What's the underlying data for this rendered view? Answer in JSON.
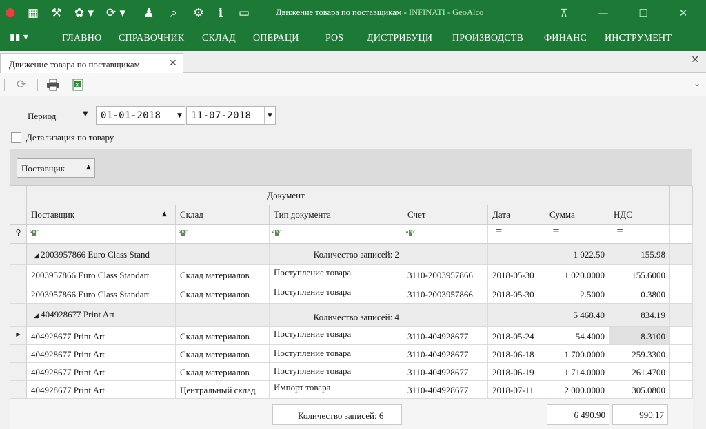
{
  "window": {
    "title": "Движение товара по поставщикам",
    "title_separator": " - ",
    "app_name": "INFINATI - GeoAlco",
    "accent_color": "#1c7a36"
  },
  "quick_toolbar": [
    {
      "name": "app-logo-icon",
      "glyph": "⬢"
    },
    {
      "name": "calendar-icon",
      "glyph": "▦"
    },
    {
      "name": "tools-icon",
      "glyph": "⚒"
    },
    {
      "name": "palette-icon",
      "glyph": "✿"
    },
    {
      "name": "refresh-icon",
      "glyph": "⟳"
    },
    {
      "name": "user-icon",
      "glyph": "♟"
    },
    {
      "name": "search-icon",
      "glyph": "⌕"
    },
    {
      "name": "settings-icon",
      "glyph": "⚙"
    },
    {
      "name": "info-icon",
      "glyph": "ℹ"
    },
    {
      "name": "chat-icon",
      "glyph": "▭"
    }
  ],
  "menu": {
    "app_button": "▮▮",
    "items": [
      "ГЛАВНО",
      "СПРАВОЧНИК",
      "СКЛАД",
      "ОПЕРАЦИ",
      "POS",
      "ДИСТРИБУЦИ",
      "ПРОИЗВОДСТВ",
      "ФИНАНС",
      "ИНСТРУМЕНТ"
    ]
  },
  "tab": {
    "label": "Движение товара по поставщикам",
    "close": "✕"
  },
  "toolbar_icons": [
    "refresh-icon",
    "print-icon",
    "excel-icon"
  ],
  "filters": {
    "period_label": "Период",
    "date_from": "01-01-2018",
    "date_to": "11-07-2018",
    "detail_label": "Детализация по товару",
    "detail_checked": false
  },
  "group_panel": {
    "chip_label": "Поставщик"
  },
  "grid": {
    "band_header": "Документ",
    "columns": [
      "Поставщик",
      "Склад",
      "Тип документа",
      "Счет",
      "Дата",
      "Сумма",
      "НДС"
    ],
    "groups": [
      {
        "title": "2003957866  Euro Class Stand",
        "count_text": "Количество записей: 2",
        "sum": "1 022.50",
        "vat": "155.98",
        "rows": [
          {
            "supplier": "2003957866  Euro Class Standart",
            "warehouse": "Склад материалов",
            "doc_type": "Поступление товара",
            "account": "3110-2003957866",
            "date": "2018-05-30",
            "sum": "1 020.0000",
            "vat": "155.6000"
          },
          {
            "supplier": "2003957866  Euro Class Standart",
            "warehouse": "Склад материалов",
            "doc_type": "Поступление товара",
            "account": "3110-2003957866",
            "date": "2018-05-30",
            "sum": "2.5000",
            "vat": "0.3800"
          }
        ]
      },
      {
        "title": "404928677  Print Art",
        "count_text": "Количество записей: 4",
        "sum": "5 468.40",
        "vat": "834.19",
        "rows": [
          {
            "supplier": "404928677  Print Art",
            "warehouse": "Склад материалов",
            "doc_type": "Поступление товара",
            "account": "3110-404928677",
            "date": "2018-05-24",
            "sum": "54.4000",
            "vat": "8.3100"
          },
          {
            "supplier": "404928677  Print Art",
            "warehouse": "Склад материалов",
            "doc_type": "Поступление товара",
            "account": "3110-404928677",
            "date": "2018-06-18",
            "sum": "1 700.0000",
            "vat": "259.3300"
          },
          {
            "supplier": "404928677  Print Art",
            "warehouse": "Склад материалов",
            "doc_type": "Поступление товара",
            "account": "3110-404928677",
            "date": "2018-06-19",
            "sum": "1 714.0000",
            "vat": "261.4700"
          },
          {
            "supplier": "404928677  Print Art",
            "warehouse": "Центральный склад",
            "doc_type": "Импорт товара",
            "account": "3110-404928677",
            "date": "2018-07-11",
            "sum": "2 000.0000",
            "vat": "305.0800"
          }
        ]
      }
    ],
    "footer": {
      "count_text": "Количество записей: 6",
      "sum": "6 490.90",
      "vat": "990.17"
    }
  }
}
